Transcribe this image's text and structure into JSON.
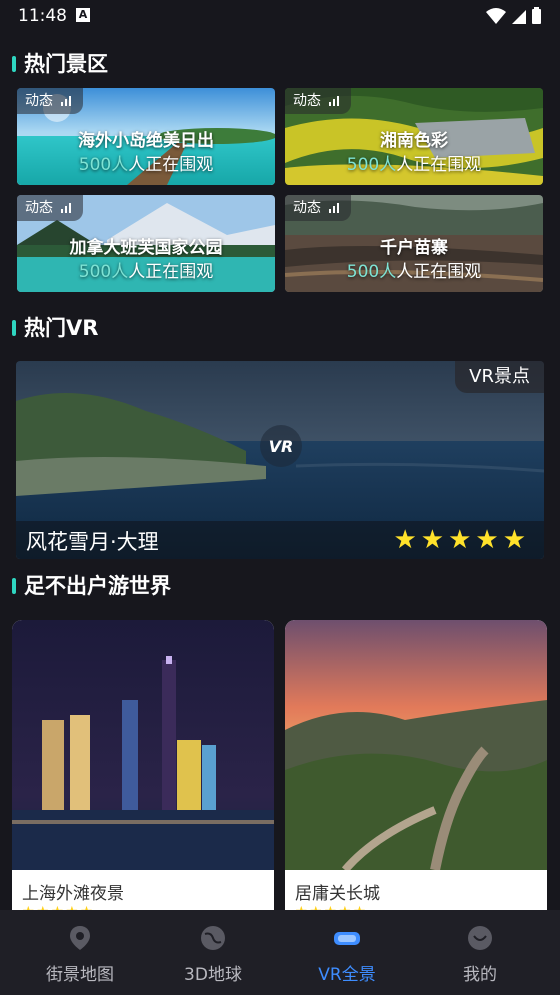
{
  "status_bar": {
    "time": "11:48",
    "notification": "A"
  },
  "sections": {
    "hot_spots": "热门景区",
    "hot_vr": "热门VR",
    "world": "足不出户游世界"
  },
  "hot_spots": [
    {
      "tag": "动态",
      "name": "海外小岛绝美日出",
      "viewer_count": "500人",
      "viewer_suffix": "人正在围观"
    },
    {
      "tag": "动态",
      "name": "湘南色彩",
      "viewer_count": "500人",
      "viewer_suffix": "人正在围观"
    },
    {
      "tag": "动态",
      "name": "加拿大班芙国家公园",
      "viewer_count": "500人",
      "viewer_suffix": "人正在围观"
    },
    {
      "tag": "动态",
      "name": "千户苗寨",
      "viewer_count": "500人",
      "viewer_suffix": "人正在围观"
    }
  ],
  "vr_banner": {
    "tag": "VR景点",
    "play_icon_label": "VR",
    "title": "风花雪月·大理",
    "stars": "★★★★★",
    "rating": 5
  },
  "world_cards": [
    {
      "name": "上海外滩夜景",
      "stars": "★★★★★"
    },
    {
      "name": "居庸关长城",
      "stars": "★★★★★"
    }
  ],
  "bottom_nav": [
    {
      "label": "街景地图",
      "icon": "map-pin-icon",
      "active": false
    },
    {
      "label": "3D地球",
      "icon": "globe-icon",
      "active": false
    },
    {
      "label": "VR全景",
      "icon": "vr-headset-icon",
      "active": true
    },
    {
      "label": "我的",
      "icon": "profile-icon",
      "active": false
    }
  ],
  "colors": {
    "accent": "#2fd6c1",
    "active_nav": "#3e8dff",
    "star": "#ffe22b",
    "background": "#17171d"
  }
}
